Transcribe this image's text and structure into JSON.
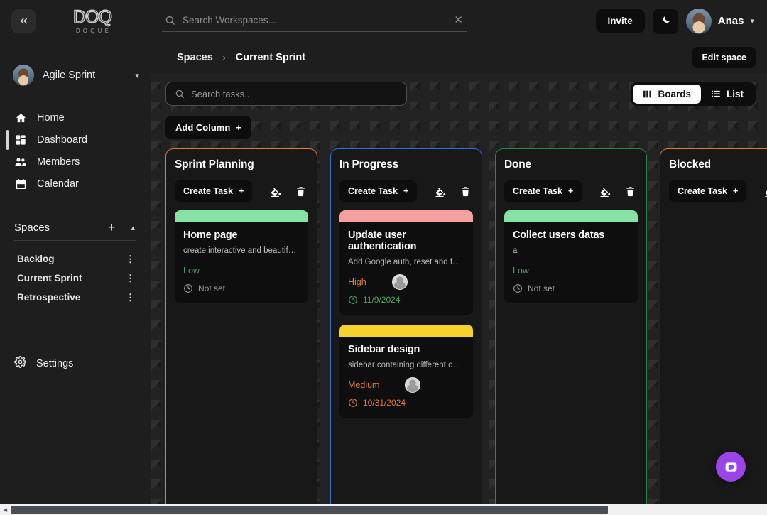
{
  "topbar": {
    "collapse_icon": "chevrons-left-icon",
    "logo_main": "DOQ",
    "logo_sub": "DOQUE",
    "search_placeholder": "Search Workspaces...",
    "search_value": "",
    "clear_icon": "close-icon",
    "invite_label": "Invite",
    "theme_icon": "moon-icon",
    "user_name": "Anas",
    "user_chevron": "chevron-down-icon"
  },
  "sidebar": {
    "workspace_name": "Agile Sprint",
    "workspace_chevron": "chevron-down-icon",
    "nav": [
      {
        "label": "Home",
        "icon": "home-icon",
        "active": false
      },
      {
        "label": "Dashboard",
        "icon": "dashboard-grid-icon",
        "active": true
      },
      {
        "label": "Members",
        "icon": "members-icon",
        "active": false
      },
      {
        "label": "Calendar",
        "icon": "calendar-icon",
        "active": false
      }
    ],
    "spaces_title": "Spaces",
    "spaces_add_icon": "plus-icon",
    "spaces_collapse_icon": "chevron-up-icon",
    "spaces": [
      {
        "label": "Backlog",
        "menu_icon": "more-vertical-icon"
      },
      {
        "label": "Current Sprint",
        "menu_icon": "more-vertical-icon"
      },
      {
        "label": "Retrospective",
        "menu_icon": "more-vertical-icon"
      }
    ],
    "settings_label": "Settings",
    "settings_icon": "gear-icon"
  },
  "main": {
    "breadcrumb": {
      "root": "Spaces",
      "separator": "›",
      "current": "Current Sprint"
    },
    "edit_space_label": "Edit space",
    "task_search_placeholder": "Search tasks..",
    "task_search_value": "",
    "view_boards_label": "Boards",
    "view_list_label": "List",
    "view_active": "Boards",
    "add_column_label": "Add Column",
    "add_column_icon": "plus-icon",
    "chat_icon": "chat-bubble-icon"
  },
  "board": {
    "create_task_label": "Create Task",
    "create_task_icon": "plus-icon",
    "fill_icon": "paint-bucket-icon",
    "trash_icon": "trash-icon",
    "columns": [
      {
        "title": "Sprint Planning",
        "border_color": "#e07b39",
        "cards": [
          {
            "title": "Home page",
            "description": "create interactive and beautiful ho…",
            "priority": "Low",
            "priority_class": "low",
            "strip_color": "#86e3a5",
            "date": "Not set",
            "date_class": "notset",
            "clock_icon": "clock-icon",
            "has_avatar": false
          }
        ]
      },
      {
        "title": "In Progress",
        "border_color": "#2f6fd0",
        "cards": [
          {
            "title": "Update user authentication",
            "description": "Add Google auth, reset and forgot …",
            "priority": "High",
            "priority_class": "high",
            "strip_color": "#f4a0a0",
            "date": "11/9/2024",
            "date_class": "green",
            "clock_icon": "clock-icon",
            "has_avatar": true
          },
          {
            "title": "Sidebar design",
            "description": "sidebar containing different option…",
            "priority": "Medium",
            "priority_class": "medium",
            "strip_color": "#f5d32f",
            "date": "10/31/2024",
            "date_class": "orange",
            "clock_icon": "clock-icon",
            "has_avatar": true
          }
        ]
      },
      {
        "title": "Done",
        "border_color": "#1f8a4c",
        "cards": [
          {
            "title": "Collect users datas",
            "description": "a",
            "priority": "Low",
            "priority_class": "low",
            "strip_color": "#86e3a5",
            "date": "Not set",
            "date_class": "notset",
            "clock_icon": "clock-icon",
            "has_avatar": false
          }
        ]
      },
      {
        "title": "Blocked",
        "border_color": "#e07b39",
        "cards": []
      }
    ]
  }
}
